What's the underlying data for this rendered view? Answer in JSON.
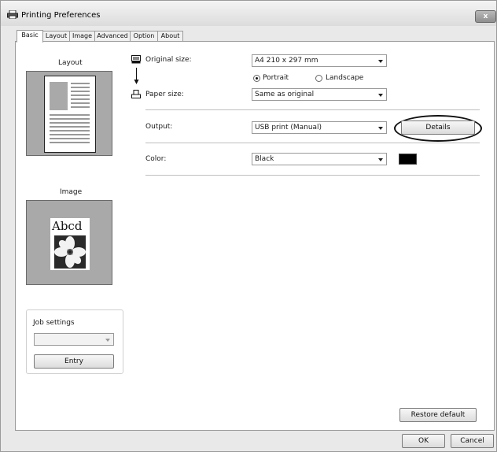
{
  "window": {
    "title": "Printing Preferences",
    "close_label": "x"
  },
  "tabs": [
    {
      "label": "Basic",
      "active": true
    },
    {
      "label": "Layout",
      "active": false
    },
    {
      "label": "Image",
      "active": false
    },
    {
      "label": "Advanced",
      "active": false
    },
    {
      "label": "Option",
      "active": false
    },
    {
      "label": "About",
      "active": false
    }
  ],
  "left": {
    "layout_title": "Layout",
    "image_title": "Image",
    "image_sample_text": "Abcd",
    "job_settings": {
      "title": "Job settings",
      "value": "",
      "entry_label": "Entry"
    }
  },
  "settings": {
    "original_size": {
      "label": "Original size:",
      "value": "A4 210 x 297 mm"
    },
    "orientation": {
      "portrait": "Portrait",
      "landscape": "Landscape",
      "selected": "Portrait"
    },
    "paper_size": {
      "label": "Paper size:",
      "value": "Same as original"
    },
    "output": {
      "label": "Output:",
      "value": "USB print (Manual)",
      "details_label": "Details"
    },
    "color": {
      "label": "Color:",
      "value": "Black",
      "swatch": "#000000"
    }
  },
  "footer": {
    "restore_label": "Restore default",
    "ok_label": "OK",
    "cancel_label": "Cancel"
  }
}
